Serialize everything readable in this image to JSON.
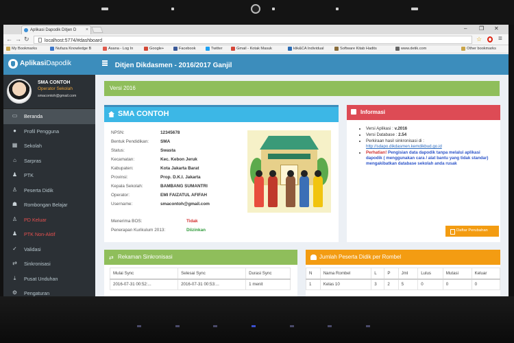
{
  "browser": {
    "tab_title": "Aplikasi Dapodik Ditjen D",
    "url": "localhost:5774/#dashboard",
    "bookmarks": [
      "My Bookmarks",
      "Nufaza Knowledge B",
      "Asana - Log In",
      "Google+",
      "Facebook",
      "Twitter",
      "Gmail - Kotak Masuk",
      "klik&CA Individual",
      "Software Kitab Hadits",
      "www.detik.com",
      "Other bookmarks"
    ]
  },
  "app": {
    "logo_bold": "Aplikasi",
    "logo_thin": "Dapodik",
    "header_title": "Ditjen Dikdasmen - 2016/2017 Ganjil"
  },
  "profile": {
    "name": "SMA CONTOH",
    "role": "Operator Sekolah",
    "email": "smacontoh@gmail.com"
  },
  "sidebar": {
    "items": [
      {
        "label": "Beranda",
        "icon": "monitor-icon",
        "active": true
      },
      {
        "label": "Profil Pengguna",
        "icon": "user-icon"
      },
      {
        "label": "Sekolah",
        "icon": "building-icon"
      },
      {
        "label": "Sarpras",
        "icon": "bank-icon"
      },
      {
        "label": "PTK",
        "icon": "user-tie-icon"
      },
      {
        "label": "Peserta Didik",
        "icon": "student-icon"
      },
      {
        "label": "Rombongan Belajar",
        "icon": "group-icon"
      },
      {
        "label": "PD Keluar",
        "icon": "student-out-icon",
        "color": "red"
      },
      {
        "label": "PTK Non-Aktif",
        "icon": "user-off-icon",
        "color": "red"
      },
      {
        "label": "Validasi",
        "icon": "check-icon"
      },
      {
        "label": "Sinkronisasi",
        "icon": "sync-icon"
      },
      {
        "label": "Pusat Unduhan",
        "icon": "download-icon"
      },
      {
        "label": "Pengaturan",
        "icon": "gear-icon"
      }
    ]
  },
  "versi": "Versi 2016",
  "school": {
    "title": "SMA CONTOH",
    "fields": [
      {
        "k": "NPSN:",
        "v": "12345678"
      },
      {
        "k": "Bentuk Pendidikan:",
        "v": "SMA"
      },
      {
        "k": "Status:",
        "v": "Swasta"
      },
      {
        "k": "Kecamatan:",
        "v": "Kec. Kebon Jeruk"
      },
      {
        "k": "Kabupaten:",
        "v": "Kota Jakarta Barat"
      },
      {
        "k": "Provinsi:",
        "v": "Prop. D.K.I. Jakarta"
      },
      {
        "k": "Kepala Sekolah:",
        "v": "BAMBANG SUMANTRI"
      },
      {
        "k": "Operator:",
        "v": "EMI FAIZATUL AFIFAH"
      },
      {
        "k": "Username:",
        "v": "smacontoh@gmail.com"
      }
    ],
    "bos_label": "Menerima BOS:",
    "bos_value": "Tidak",
    "kurikulum_label": "Penerapan Kurikulum 2013:",
    "kurikulum_value": "Diizinkan",
    "colors": {
      "tidak": "#d32f2f",
      "diizinkan": "#2e9a3a"
    }
  },
  "info": {
    "title": "Informasi",
    "versi_label": "Versi Aplikasi : ",
    "versi_value": "v.2016",
    "db_label": "Versi Database : ",
    "db_value": "2.54",
    "perkiraan": "Perkiraan hasil sinkronisasi di :",
    "link": "http://sdapo.dikdasmen.kemdikbud.go.id",
    "perhatian": "Perhatian!",
    "warning": " Pengisian data dapodik tanpa melalui aplikasi dapodik ( menggunakan cara / alat bantu yang tidak standar) mengakibatkan database sekolah anda rusak",
    "button": "Daftar Perubahan"
  },
  "rekaman": {
    "title": "Rekaman Sinkronisasi",
    "headers": [
      "Mulai Sync",
      "Selesai Sync",
      "Durasi Sync"
    ],
    "rows": [
      [
        "2016-07-31 00:52:...",
        "2016-07-31 00:53:...",
        "1 menit"
      ]
    ]
  },
  "jumlah": {
    "title": "Jumlah Peserta Didik per Rombel",
    "headers": [
      "N",
      "Nama Rombel",
      "L",
      "P",
      "Jml",
      "Lulus",
      "Mutasi",
      "Keluar"
    ],
    "rows": [
      [
        "1",
        "Kelas 10",
        "3",
        "2",
        "5",
        "0",
        "0",
        "0"
      ]
    ]
  }
}
